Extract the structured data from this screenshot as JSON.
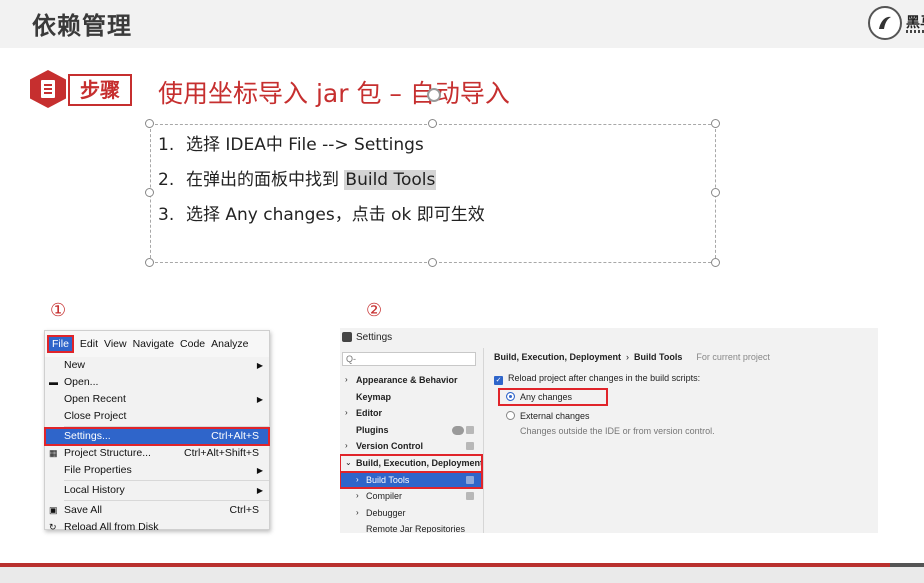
{
  "header": {
    "title": "依赖管理",
    "logo_text": "黑马"
  },
  "step": {
    "badge": "步骤",
    "heading": "使用坐标导入 jar 包 – 自动导入"
  },
  "instructions": [
    {
      "num": "1.",
      "text": "选择 IDEA中 File --> Settings",
      "highlight": ""
    },
    {
      "num": "2.",
      "text": "在弹出的面板中找到 ",
      "highlight": "Build Tools"
    },
    {
      "num": "3.",
      "text": "选择 Any changes，点击 ok 即可生效",
      "highlight": ""
    }
  ],
  "figure_labels": {
    "one": "①",
    "two": "②"
  },
  "ide_menu": {
    "menubar": [
      "File",
      "Edit",
      "View",
      "Navigate",
      "Code",
      "Analyze"
    ],
    "items": [
      {
        "label": "New",
        "shortcut": "",
        "submenu": true
      },
      {
        "label": "Open...",
        "shortcut": "",
        "submenu": false
      },
      {
        "label": "Open Recent",
        "shortcut": "",
        "submenu": true
      },
      {
        "label": "Close Project",
        "shortcut": "",
        "submenu": false
      },
      {
        "label": "Settings...",
        "shortcut": "Ctrl+Alt+S",
        "submenu": false,
        "selected": true
      },
      {
        "label": "Project Structure...",
        "shortcut": "Ctrl+Alt+Shift+S",
        "submenu": false
      },
      {
        "label": "File Properties",
        "shortcut": "",
        "submenu": true
      },
      {
        "label": "Local History",
        "shortcut": "",
        "submenu": true
      },
      {
        "label": "Save All",
        "shortcut": "Ctrl+S",
        "submenu": false
      },
      {
        "label": "Reload All from Disk",
        "shortcut": "",
        "submenu": false
      }
    ]
  },
  "settings_dialog": {
    "title": "Settings",
    "search_placeholder": "Q-",
    "tree": [
      {
        "label": "Appearance & Behavior",
        "toggle": "›",
        "child": false
      },
      {
        "label": "Keymap",
        "toggle": "",
        "child": false
      },
      {
        "label": "Editor",
        "toggle": "›",
        "child": false
      },
      {
        "label": "Plugins",
        "toggle": "",
        "child": false
      },
      {
        "label": "Version Control",
        "toggle": "›",
        "child": false
      },
      {
        "label": "Build, Execution, Deployment",
        "toggle": "⌄",
        "child": false
      },
      {
        "label": "Build Tools",
        "toggle": "›",
        "child": true
      },
      {
        "label": "Compiler",
        "toggle": "›",
        "child": true
      },
      {
        "label": "Debugger",
        "toggle": "›",
        "child": true
      },
      {
        "label": "Remote Jar Repositories",
        "toggle": "",
        "child": true
      }
    ],
    "breadcrumb": {
      "parent": "Build, Execution, Deployment",
      "separator": "›",
      "current": "Build Tools",
      "scope": "For current project"
    },
    "reload_label": "Reload project after changes in the build scripts:",
    "options": [
      {
        "label": "Any changes",
        "checked": true
      },
      {
        "label": "External changes",
        "checked": false
      }
    ],
    "external_desc": "Changes outside the IDE or from version control."
  },
  "colors": {
    "accent_red": "#c62f2f",
    "selection_blue": "#2f65ca",
    "highlight_red_box": "#e0242a"
  }
}
